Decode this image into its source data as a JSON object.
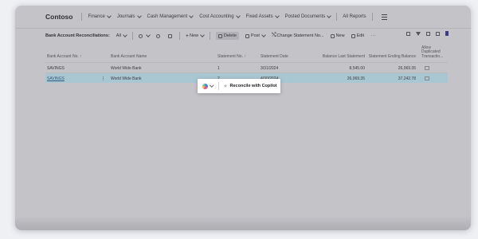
{
  "nav": {
    "brand": "Contoso",
    "items": [
      "Finance",
      "Journals",
      "Cash Management",
      "Cost Accounting",
      "Fixed Assets",
      "Posted Documents"
    ],
    "all_reports": "All Reports"
  },
  "actions": {
    "page_label": "Bank Account Reconciliations:",
    "view": "All",
    "new": "New",
    "delete": "Delete",
    "post": "Post",
    "change_statement": "Change Statement No...",
    "new2": "New",
    "edit": "Edit"
  },
  "table": {
    "headers": {
      "acct": "Bank Account No. ↑",
      "name": "Bank Account Name",
      "stmt": "Statement No. ↑",
      "date": "Statement Date",
      "balance": "Balance Last Statement",
      "ending": "Statement Ending Balance",
      "dup": "Allow Duplicated Transactio..."
    },
    "rows": [
      {
        "acct": "SAVINGS",
        "name": "World Wide Bank",
        "stmt": "1",
        "date": "3/31/2024",
        "balance": "8,545.00",
        "ending": "26,069.35"
      },
      {
        "acct": "SAVINGS",
        "name": "World Wide Bank",
        "stmt": "2",
        "date": "4/30/2024",
        "balance": "26,069.35",
        "ending": "37,242.78"
      }
    ]
  },
  "popup": {
    "reconcile": "Reconcile with Copilot"
  }
}
